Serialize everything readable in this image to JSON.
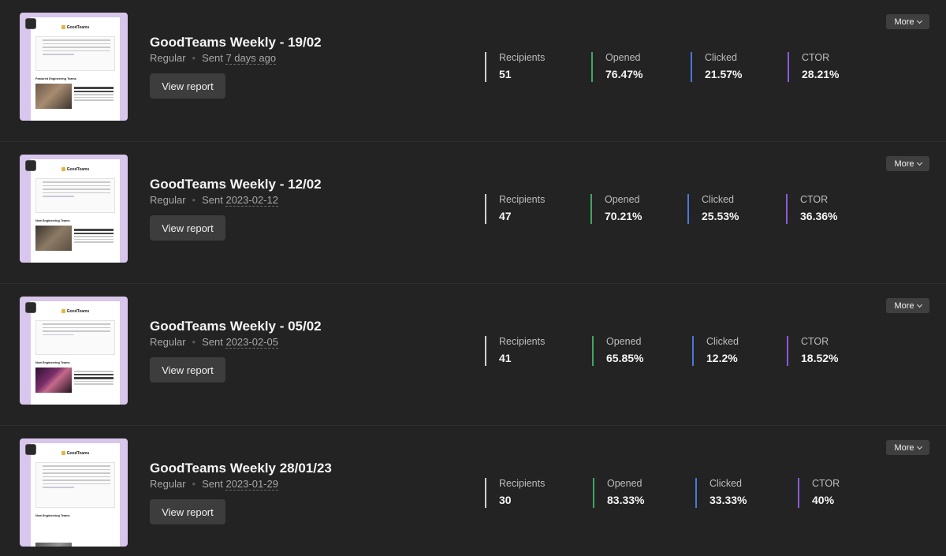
{
  "campaigns": [
    {
      "title": "GoodTeams Weekly - 19/02",
      "type": "Regular",
      "sent_label": "Sent",
      "sent_value": "7 days ago",
      "button": "View report",
      "more": "More",
      "stats": [
        {
          "label": "Recipients",
          "value": "51"
        },
        {
          "label": "Opened",
          "value": "76.47%"
        },
        {
          "label": "Clicked",
          "value": "21.57%"
        },
        {
          "label": "CTOR",
          "value": "28.21%"
        }
      ],
      "thumb": {
        "logo": "GoodTeams",
        "section": "Featured Engineering Teams"
      }
    },
    {
      "title": "GoodTeams Weekly - 12/02",
      "type": "Regular",
      "sent_label": "Sent",
      "sent_value": "2023-02-12",
      "button": "View report",
      "more": "More",
      "stats": [
        {
          "label": "Recipients",
          "value": "47"
        },
        {
          "label": "Opened",
          "value": "70.21%"
        },
        {
          "label": "Clicked",
          "value": "25.53%"
        },
        {
          "label": "CTOR",
          "value": "36.36%"
        }
      ],
      "thumb": {
        "logo": "GoodTeams",
        "section": "New Engineering Teams"
      }
    },
    {
      "title": "GoodTeams Weekly - 05/02",
      "type": "Regular",
      "sent_label": "Sent",
      "sent_value": "2023-02-05",
      "button": "View report",
      "more": "More",
      "stats": [
        {
          "label": "Recipients",
          "value": "41"
        },
        {
          "label": "Opened",
          "value": "65.85%"
        },
        {
          "label": "Clicked",
          "value": "12.2%"
        },
        {
          "label": "CTOR",
          "value": "18.52%"
        }
      ],
      "thumb": {
        "logo": "GoodTeams",
        "section": "New Engineering Teams"
      }
    },
    {
      "title": "GoodTeams Weekly 28/01/23",
      "type": "Regular",
      "sent_label": "Sent",
      "sent_value": "2023-01-29",
      "button": "View report",
      "more": "More",
      "stats": [
        {
          "label": "Recipients",
          "value": "30"
        },
        {
          "label": "Opened",
          "value": "83.33%"
        },
        {
          "label": "Clicked",
          "value": "33.33%"
        },
        {
          "label": "CTOR",
          "value": "40%"
        }
      ],
      "thumb": {
        "logo": "GoodTeams",
        "section": "New Engineering Teams"
      }
    }
  ],
  "colors": {
    "recipients": "#cfcfcf",
    "opened": "#3fa85f",
    "clicked": "#4a78d8",
    "ctor": "#8d5ad8"
  }
}
